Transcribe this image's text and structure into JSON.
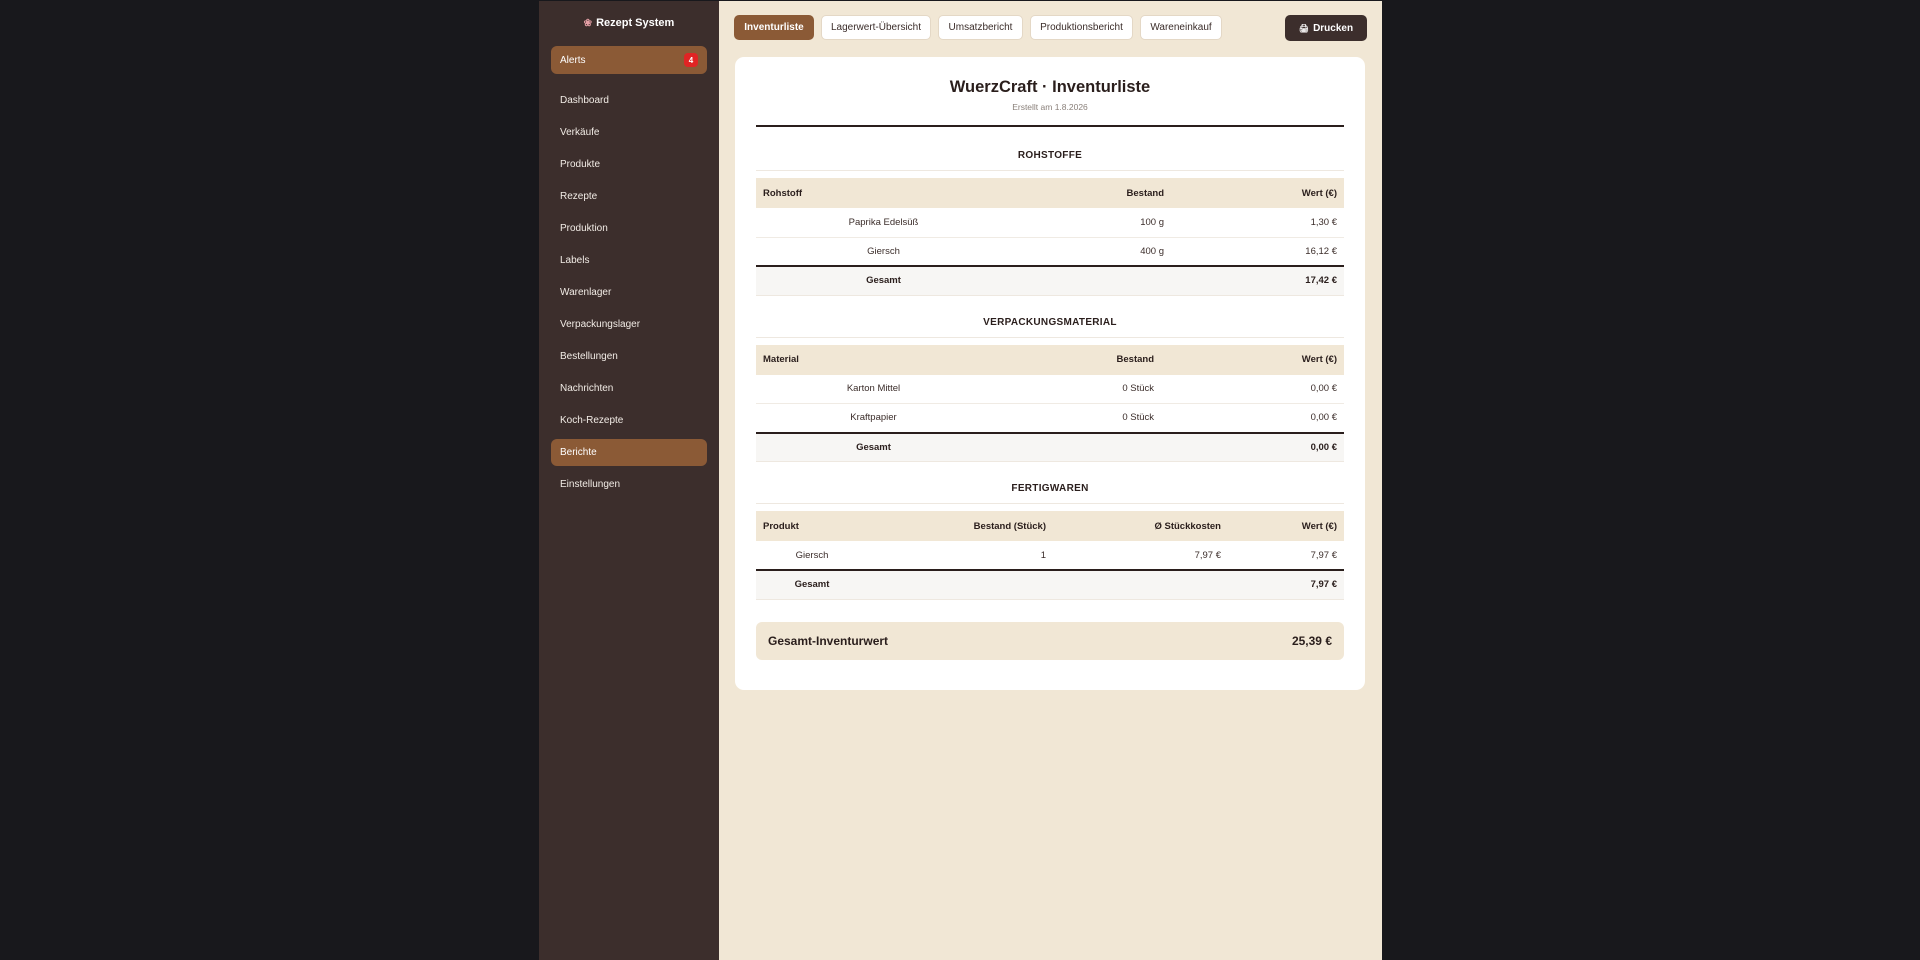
{
  "sidebar": {
    "brand_icon": "brain-icon",
    "brand": "Rezept System",
    "alerts_label": "Alerts",
    "alerts_count": "4",
    "items": [
      "Dashboard",
      "Verkäufe",
      "Produkte",
      "Rezepte",
      "Produktion",
      "Labels",
      "Warenlager",
      "Verpackungslager",
      "Bestellungen",
      "Nachrichten",
      "Koch-Rezepte",
      "Berichte",
      "Einstellungen"
    ],
    "active_item": "Berichte"
  },
  "toolbar": {
    "tabs": [
      "Inventurliste",
      "Lagerwert-Übersicht",
      "Umsatzbericht",
      "Produktionsbericht",
      "Wareneinkauf"
    ],
    "active_tab": "Inventurliste",
    "print_icon": "printer-icon",
    "print_label": "Drucken"
  },
  "report": {
    "title": "WuerzCraft · Inventurliste",
    "subtitle": "Erstellt am 1.8.2026",
    "rohstoffe": {
      "title": "ROHSTOFFE",
      "headers": [
        "Rohstoff",
        "Bestand",
        "Wert (€)"
      ],
      "rows": [
        [
          "Paprika Edelsüß",
          "100 g",
          "1,30 €"
        ],
        [
          "Giersch",
          "400 g",
          "16,12 €"
        ]
      ],
      "total": [
        "Gesamt",
        "",
        "17,42 €"
      ]
    },
    "verpackung": {
      "title": "VERPACKUNGSMATERIAL",
      "headers": [
        "Material",
        "Bestand",
        "Wert (€)"
      ],
      "rows": [
        [
          "Karton Mittel",
          "0 Stück",
          "0,00 €"
        ],
        [
          "Kraftpapier",
          "0 Stück",
          "0,00 €"
        ]
      ],
      "total": [
        "Gesamt",
        "",
        "0,00 €"
      ]
    },
    "fertigwaren": {
      "title": "FERTIGWAREN",
      "headers": [
        "Produkt",
        "Bestand (Stück)",
        "Ø Stückkosten",
        "Wert (€)"
      ],
      "rows": [
        [
          "Giersch",
          "1",
          "7,97 €",
          "7,97 €"
        ]
      ],
      "total": [
        "Gesamt",
        "",
        "",
        "7,97 €"
      ]
    },
    "grand_total_label": "Gesamt-Inventurwert",
    "grand_total_value": "25,39 €"
  }
}
